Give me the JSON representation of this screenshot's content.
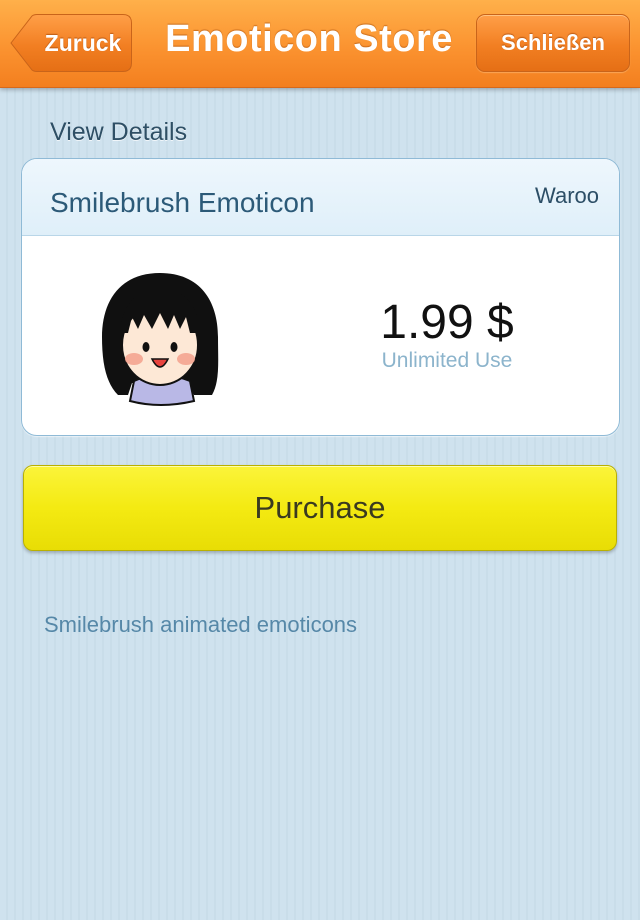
{
  "nav": {
    "back_label": "Zuruck",
    "title": "Emoticon Store",
    "close_label": "Schließen"
  },
  "section_label": "View Details",
  "item": {
    "name": "Smilebrush Emoticon",
    "author": "Waroo",
    "price": "1.99 $",
    "license": "Unlimited Use",
    "image_icon": "girl-emoticon-icon"
  },
  "purchase_label": "Purchase",
  "description": "Smilebrush animated emoticons",
  "colors": {
    "navbar": "#fb9330",
    "background": "#cfe2ee",
    "purchase_button": "#f4ea12",
    "accent_text": "#2c5a78"
  }
}
